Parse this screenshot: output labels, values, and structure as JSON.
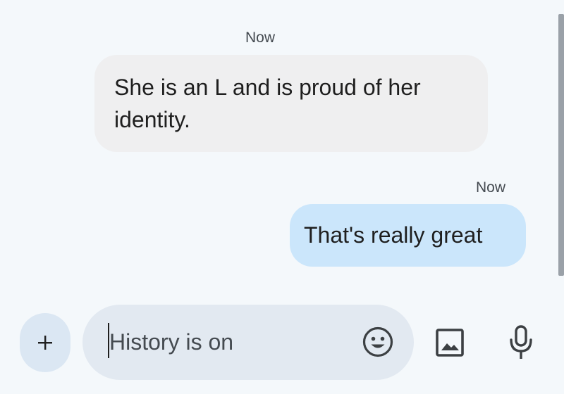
{
  "messages": [
    {
      "direction": "incoming",
      "timestamp": "Now",
      "text": "She is an L and is proud of her identity."
    },
    {
      "direction": "outgoing",
      "timestamp": "Now",
      "text": "That's really great"
    }
  ],
  "composer": {
    "placeholder": "History is on",
    "add_icon": "plus-icon",
    "emoji_icon": "emoji-icon",
    "gallery_icon": "image-icon",
    "voice_icon": "microphone-icon"
  },
  "colors": {
    "background": "#f4f8fb",
    "incoming_bubble": "#efeff0",
    "outgoing_bubble": "#cbe6fb",
    "compose_field": "#e2e9f1",
    "add_button": "#dbe7f3",
    "icon": "#3c4043"
  }
}
